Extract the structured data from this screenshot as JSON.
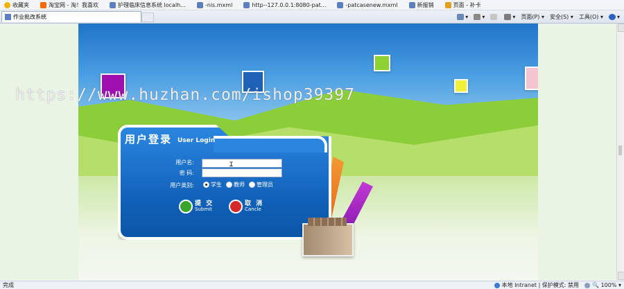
{
  "favorites_bar": {
    "items": [
      {
        "label": "收藏夹",
        "icon": "star-icon",
        "color": "#f0b400"
      },
      {
        "label": "淘宝网 - 淘！我喜欢",
        "icon": "taobao-icon",
        "color": "#ff6a00"
      },
      {
        "label": "护理临床信息系统 localh...",
        "icon": "page-icon",
        "color": "#5b7fbf"
      },
      {
        "label": "-nis.mxml",
        "icon": "page-icon",
        "color": "#5b7fbf"
      },
      {
        "label": "http--127.0.0.1:8080-pat...",
        "icon": "page-icon",
        "color": "#5b7fbf"
      },
      {
        "label": "-patcasenew.mxml",
        "icon": "page-icon",
        "color": "#5b7fbf"
      },
      {
        "label": "新报销",
        "icon": "page-icon",
        "color": "#5b7fbf"
      },
      {
        "label": "页面 - 补卡",
        "icon": "page-icon",
        "color": "#e0a020"
      }
    ]
  },
  "tab": {
    "title": "作业批改系统"
  },
  "command_bar": {
    "page": "页面(P)",
    "safety": "安全(S)",
    "tools": "工具(O)"
  },
  "watermark": "https://www.huzhan.com/ishop39397",
  "login": {
    "title": "用户登录",
    "subtitle": "User Login",
    "username_label": "用户名:",
    "password_label": "密  码:",
    "usertype_label": "用户类别:",
    "username_value": "",
    "password_value": "",
    "user_types": [
      "学生",
      "教师",
      "管理员"
    ],
    "selected_type": "学生",
    "submit_zh": "提 交",
    "submit_en": "Submit",
    "cancel_zh": "取 消",
    "cancel_en": "Cancle"
  },
  "status_bar": {
    "left": "完成",
    "zone": "本地 Intranet | 保护模式: 禁用",
    "zoom": "100%"
  }
}
